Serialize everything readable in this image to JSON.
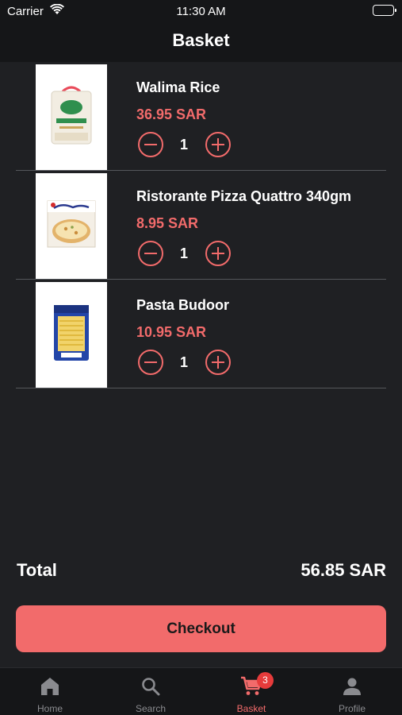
{
  "status_bar": {
    "carrier": "Carrier",
    "time": "11:30 AM"
  },
  "nav": {
    "title": "Basket"
  },
  "basket": {
    "items": [
      {
        "name": "Walima Rice",
        "price": "36.95 SAR",
        "quantity": "1",
        "image_icon": "rice-bag-icon"
      },
      {
        "name": "Ristorante Pizza Quattro 340gm",
        "price": "8.95 SAR",
        "quantity": "1",
        "image_icon": "pizza-box-icon"
      },
      {
        "name": "Pasta Budoor",
        "price": "10.95 SAR",
        "quantity": "1",
        "image_icon": "pasta-bag-icon"
      }
    ]
  },
  "summary": {
    "total_label": "Total",
    "total_value": "56.85 SAR"
  },
  "checkout": {
    "label": "Checkout"
  },
  "tabs": [
    {
      "label": "Home",
      "icon": "home-icon",
      "active": false
    },
    {
      "label": "Search",
      "icon": "search-icon",
      "active": false
    },
    {
      "label": "Basket",
      "icon": "cart-icon",
      "active": true,
      "badge": "3"
    },
    {
      "label": "Profile",
      "icon": "profile-icon",
      "active": false
    }
  ],
  "colors": {
    "background": "#1f2023",
    "bar_background": "#151618",
    "accent": "#f26b6b",
    "badge": "#e63b3b",
    "inactive": "#8a8b8f"
  }
}
